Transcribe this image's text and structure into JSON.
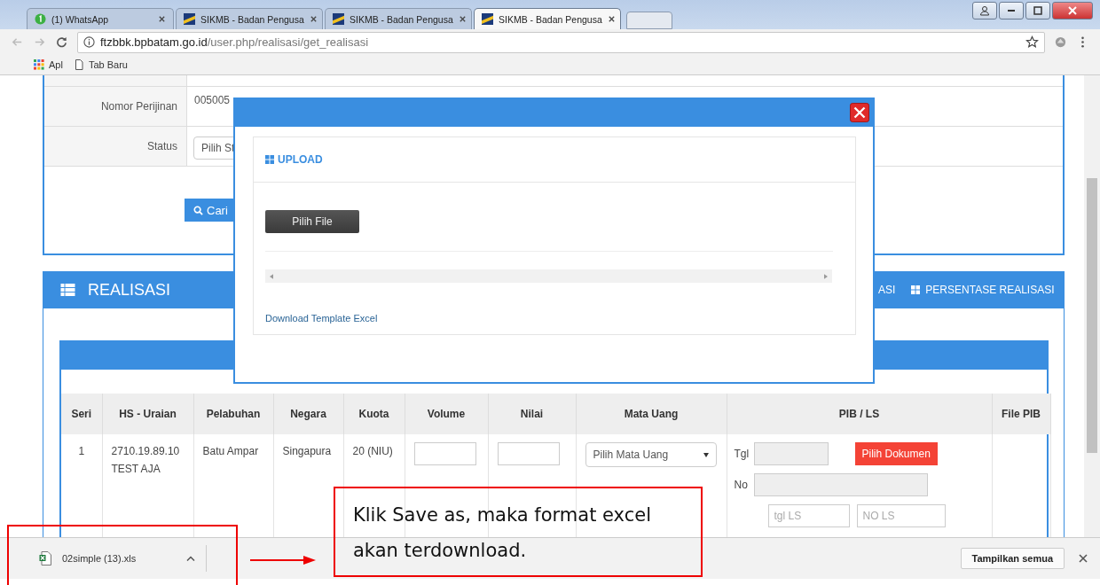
{
  "browser": {
    "tabs": [
      {
        "title": "(1) WhatsApp",
        "kind": "whatsapp",
        "selected": false
      },
      {
        "title": "SIKMB - Badan Pengusa",
        "kind": "sikmb",
        "selected": false
      },
      {
        "title": "SIKMB - Badan Pengusa",
        "kind": "sikmb",
        "selected": false
      },
      {
        "title": "SIKMB - Badan Pengusa",
        "kind": "sikmb",
        "selected": true
      }
    ],
    "address": {
      "host": "ftzbbk.bpbatam.go.id",
      "path": "/user.php/realisasi/get_realisasi"
    },
    "bookmarks": [
      {
        "label": "Apl",
        "kind": "apps"
      },
      {
        "label": "Tab Baru",
        "kind": "page"
      }
    ]
  },
  "filter_form": {
    "rows": [
      {
        "label": "Nomor Perijinan",
        "kind": "text",
        "value": "005005"
      },
      {
        "label": "Status",
        "kind": "select",
        "value": "Pilih St"
      }
    ],
    "search_button": "Cari"
  },
  "realisasi": {
    "title": "REALISASI",
    "header_links": [
      {
        "label": "ASI",
        "icon": false
      },
      {
        "label": "PERSENTASE REALISASI",
        "icon": true
      }
    ],
    "table": {
      "columns": [
        "Seri",
        "HS - Uraian",
        "Pelabuhan",
        "Negara",
        "Kuota",
        "Volume",
        "Nilai",
        "Mata Uang",
        "PIB / LS",
        "File PIB"
      ],
      "rows": [
        {
          "seri": "1",
          "hs": "2710.19.89.10",
          "uraian": "TEST AJA",
          "pelabuhan": "Batu Ampar",
          "negara": "Singapura",
          "kuota": "20 (NIU)",
          "currency_placeholder": "Pilih Mata Uang",
          "tgl_label": "Tgl",
          "no_label": "No",
          "document_button": "Pilih Dokumen",
          "tgl_ls_placeholder": "tgl LS",
          "no_ls_placeholder": "NO LS"
        }
      ]
    }
  },
  "upload_modal": {
    "section_title": "UPLOAD",
    "file_button": "Pilih File",
    "template_link": "Download Template Excel"
  },
  "download_bar": {
    "file_name": "02simple (13).xls",
    "show_all_button": "Tampilkan semua"
  },
  "annotation": {
    "text": "Klik Save as, maka format excel akan terdownload."
  }
}
